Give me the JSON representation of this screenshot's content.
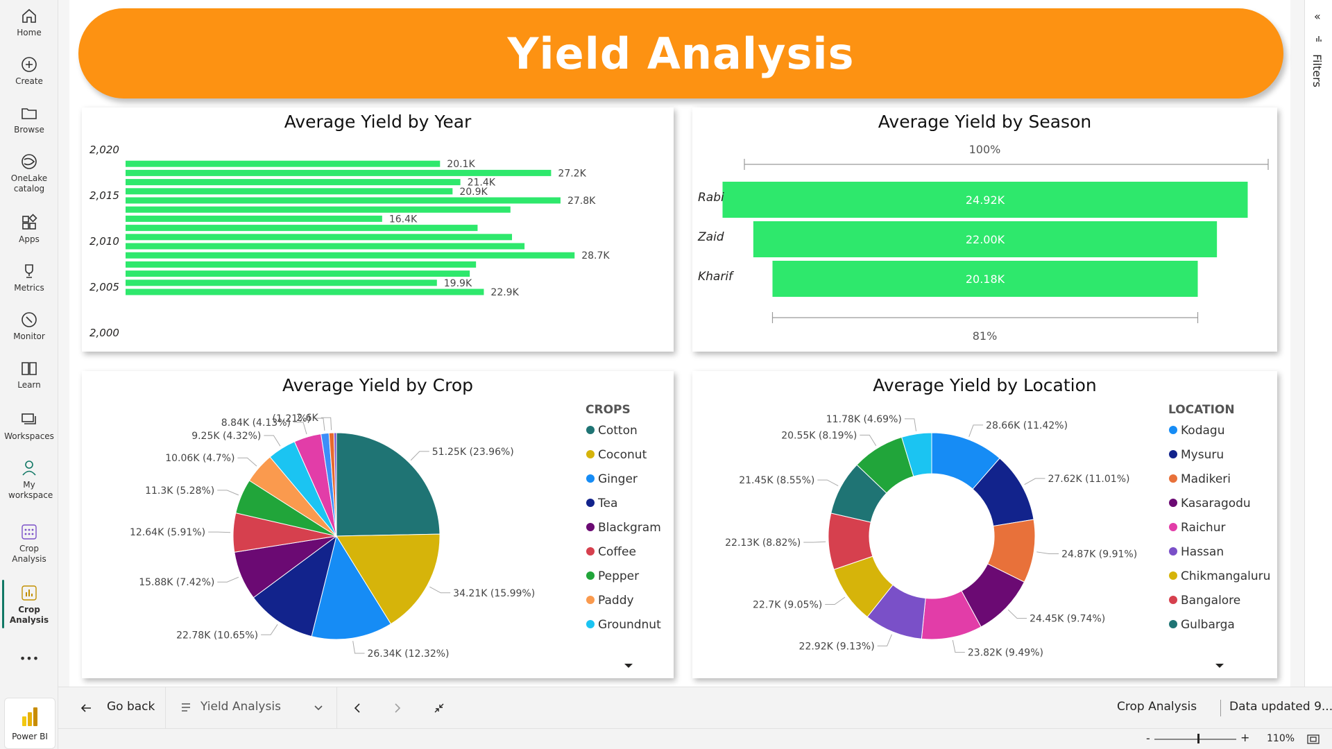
{
  "nav": {
    "items": [
      {
        "label": "Home",
        "icon": "home-icon"
      },
      {
        "label": "Create",
        "icon": "plus-circle-icon"
      },
      {
        "label": "Browse",
        "icon": "folder-icon"
      },
      {
        "label": "OneLake catalog",
        "icon": "onelake-icon"
      },
      {
        "label": "Apps",
        "icon": "apps-icon"
      },
      {
        "label": "Metrics",
        "icon": "trophy-icon"
      },
      {
        "label": "Monitor",
        "icon": "monitor-icon"
      },
      {
        "label": "Learn",
        "icon": "book-icon"
      },
      {
        "label": "Workspaces",
        "icon": "workspaces-icon"
      },
      {
        "label": "My workspace",
        "icon": "person-icon"
      },
      {
        "label": "Crop Analysis",
        "icon": "dots-grid-icon"
      },
      {
        "label": "Crop Analysis",
        "icon": "report-icon"
      }
    ],
    "more": "•••",
    "powerbi_label": "Power BI"
  },
  "banner": {
    "title": "Yield Analysis",
    "color": "#fd9212"
  },
  "filters": {
    "label": "Filters",
    "collapse": "«"
  },
  "colors": {
    "bar": "#2ee86c"
  },
  "charts": {
    "year": {
      "title": "Average Yield by Year",
      "ticks": [
        "2,020",
        "2,015",
        "2,010",
        "2,005",
        "2,000"
      ]
    },
    "season": {
      "title": "Average Yield by Season",
      "top_pct": "100%",
      "bottom_pct": "81%"
    },
    "crop": {
      "title": "Average Yield by Crop",
      "legend_title": "CROPS"
    },
    "location": {
      "title": "Average Yield by Location",
      "legend_title": "LOCATION"
    }
  },
  "chart_data": [
    {
      "type": "bar",
      "title": "Average Yield by Year",
      "orientation": "horizontal",
      "axis": "year",
      "ylim": [
        2000,
        2020
      ],
      "xlim": [
        0,
        29000
      ],
      "data": [
        {
          "year": 2019,
          "value": 20100,
          "label": "20.1K"
        },
        {
          "year": 2018,
          "value": 27200,
          "label": "27.2K"
        },
        {
          "year": 2017,
          "value": 21400,
          "label": "21.4K"
        },
        {
          "year": 2016,
          "value": 20900,
          "label": "20.9K"
        },
        {
          "year": 2015,
          "value": 27800,
          "label": "27.8K"
        },
        {
          "year": 2014,
          "value": 24600,
          "label": ""
        },
        {
          "year": 2013,
          "value": 16400,
          "label": "16.4K"
        },
        {
          "year": 2012,
          "value": 22500,
          "label": ""
        },
        {
          "year": 2011,
          "value": 24700,
          "label": ""
        },
        {
          "year": 2010,
          "value": 25500,
          "label": ""
        },
        {
          "year": 2009,
          "value": 28700,
          "label": "28.7K"
        },
        {
          "year": 2008,
          "value": 22400,
          "label": ""
        },
        {
          "year": 2007,
          "value": 22000,
          "label": ""
        },
        {
          "year": 2006,
          "value": 19900,
          "label": "19.9K"
        },
        {
          "year": 2005,
          "value": 22900,
          "label": "22.9K"
        }
      ]
    },
    {
      "type": "funnel",
      "title": "Average Yield by Season",
      "categories": [
        "Rabi",
        "Zaid",
        "Kharif"
      ],
      "values": [
        24920,
        22000,
        20180
      ],
      "labels": [
        "24.92K",
        "22.00K",
        "20.18K"
      ]
    },
    {
      "type": "pie",
      "title": "Average Yield by Crop",
      "legend": "CROPS",
      "slices": [
        {
          "name": "Cotton",
          "value": 51250,
          "label": "51.25K (23.96%)",
          "color": "#1f7474"
        },
        {
          "name": "Coconut",
          "value": 34210,
          "label": "34.21K (15.99%)",
          "color": "#d6b40a"
        },
        {
          "name": "Ginger",
          "value": 26340,
          "label": "26.34K (12.32%)",
          "color": "#168cf5"
        },
        {
          "name": "Tea",
          "value": 22780,
          "label": "22.78K (10.65%)",
          "color": "#12238c"
        },
        {
          "name": "Blackgram",
          "value": 15880,
          "label": "15.88K (7.42%)",
          "color": "#6b0a73"
        },
        {
          "name": "Coffee",
          "value": 12640,
          "label": "12.64K (5.91%)",
          "color": "#d6404e"
        },
        {
          "name": "Pepper",
          "value": 11300,
          "label": "11.3K (5.28%)",
          "color": "#21a53a"
        },
        {
          "name": "Paddy",
          "value": 10060,
          "label": "10.06K (4.7%)",
          "color": "#fa9a4e"
        },
        {
          "name": "Groundnut",
          "value": 9250,
          "label": "9.25K (4.32%)",
          "color": "#1bc4f2"
        },
        {
          "name": "",
          "value": 8840,
          "label": "8.84K (4.13%)",
          "color": "#e23da8"
        },
        {
          "name": "",
          "value": 2580,
          "label": "(1.21%)",
          "color": "#3d8ef8"
        },
        {
          "name": "",
          "value": 1600,
          "label": "2.6K",
          "color": "#e86a2e"
        },
        {
          "name": "",
          "value": 800,
          "label": "",
          "color": "#7a50c8"
        }
      ]
    },
    {
      "type": "donut",
      "title": "Average Yield by Location",
      "legend": "LOCATION",
      "slices": [
        {
          "name": "Kodagu",
          "value": 28660,
          "label": "28.66K (11.42%)",
          "color": "#168cf5"
        },
        {
          "name": "Mysuru",
          "value": 27620,
          "label": "27.62K (11.01%)",
          "color": "#12238c"
        },
        {
          "name": "Madikeri",
          "value": 24870,
          "label": "24.87K (9.91%)",
          "color": "#e8713a"
        },
        {
          "name": "Kasaragodu",
          "value": 24450,
          "label": "24.45K (9.74%)",
          "color": "#6b0a73"
        },
        {
          "name": "Raichur",
          "value": 23820,
          "label": "23.82K (9.49%)",
          "color": "#e23da8"
        },
        {
          "name": "Hassan",
          "value": 22920,
          "label": "22.92K (9.13%)",
          "color": "#7a50c8"
        },
        {
          "name": "Chikmangaluru",
          "value": 22700,
          "label": "22.7K (9.05%)",
          "color": "#d6b40a"
        },
        {
          "name": "Bangalore",
          "value": 22130,
          "label": "22.13K (8.82%)",
          "color": "#d6404e"
        },
        {
          "name": "Gulbarga",
          "value": 21450,
          "label": "21.45K (8.55%)",
          "color": "#1f7474"
        },
        {
          "name": "",
          "value": 20550,
          "label": "20.55K (8.19%)",
          "color": "#21a53a"
        },
        {
          "name": "",
          "value": 11780,
          "label": "11.78K (4.69%)",
          "color": "#1bc4f2"
        }
      ]
    }
  ],
  "bottom": {
    "go_back": "Go back",
    "page": "Yield Analysis",
    "report_name": "Crop Analysis",
    "data_updated": "Data updated 9...",
    "zoom": "110%"
  }
}
